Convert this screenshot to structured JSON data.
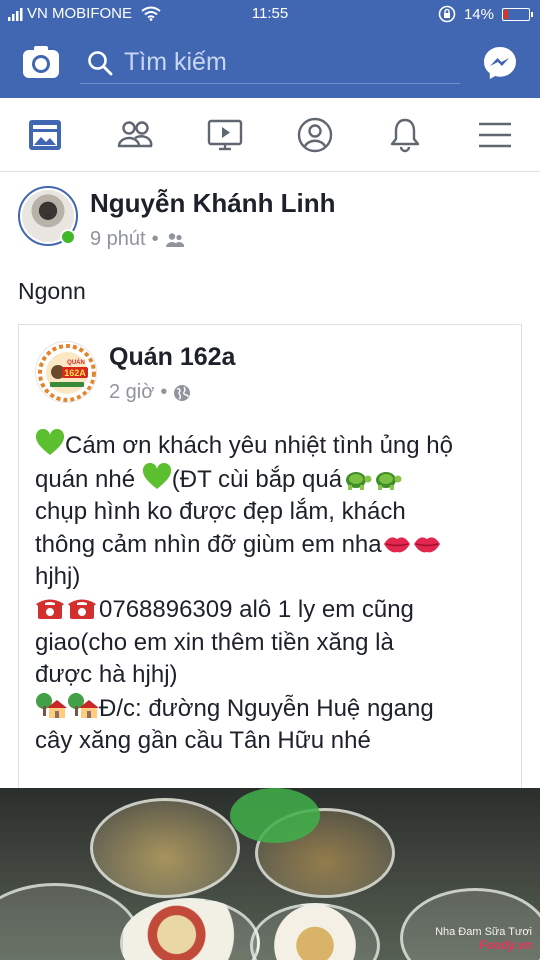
{
  "status_bar": {
    "carrier": "VN MOBIFONE",
    "time": "11:55",
    "battery": "14%",
    "battery_fraction": 0.14
  },
  "header": {
    "search_placeholder": "Tìm kiếm",
    "camera_icon": "camera-icon",
    "messenger_icon": "messenger-icon"
  },
  "nav_tabs": [
    {
      "name": "tab-news-feed",
      "icon": "news-feed-icon",
      "active": true
    },
    {
      "name": "tab-friends",
      "icon": "friends-icon",
      "active": false
    },
    {
      "name": "tab-watch",
      "icon": "video-icon",
      "active": false
    },
    {
      "name": "tab-profile",
      "icon": "profile-icon",
      "active": false
    },
    {
      "name": "tab-notifications",
      "icon": "bell-icon",
      "active": false
    },
    {
      "name": "tab-menu",
      "icon": "menu-icon",
      "active": false
    }
  ],
  "post": {
    "author": "Nguyễn Khánh Linh",
    "time": "9 phút",
    "separator": "•",
    "audience_icon": "friends-audience-icon",
    "text": "Ngonn"
  },
  "shared_post": {
    "page_name": "Quán 162a",
    "time": "2 giờ",
    "separator": "•",
    "audience_icon": "globe-icon",
    "logo_text": "162A",
    "logo_subtext": "QUÁN",
    "lines": {
      "l1": "Cám ơn khách yêu nhiệt tình ủng hộ",
      "l2a": "quán nhé ",
      "l2b": "(ĐT cùi bắp quá",
      "l3": "chụp hình ko được đẹp lắm, khách",
      "l4": "thông cảm nhìn đỡ giùm em nha",
      "l5": "hjhj)",
      "l6": "0768896309 alô 1 ly em cũng",
      "l7": "giao(cho em xin thêm tiền xăng là",
      "l8": "được hà hjhj)",
      "l9": "Đ/c: đường Nguyễn Huệ ngang",
      "l10": "cây xăng gần cầu Tân Hữu nhé"
    }
  },
  "photo": {
    "watermark_caption": "Nha Đam Sữa Tươi",
    "watermark_brand": "Foody.vn"
  },
  "colors": {
    "facebook_blue": "#4267b2",
    "online_green": "#42b72a",
    "meta_gray": "#90949c",
    "text_dark": "#1d2129"
  }
}
